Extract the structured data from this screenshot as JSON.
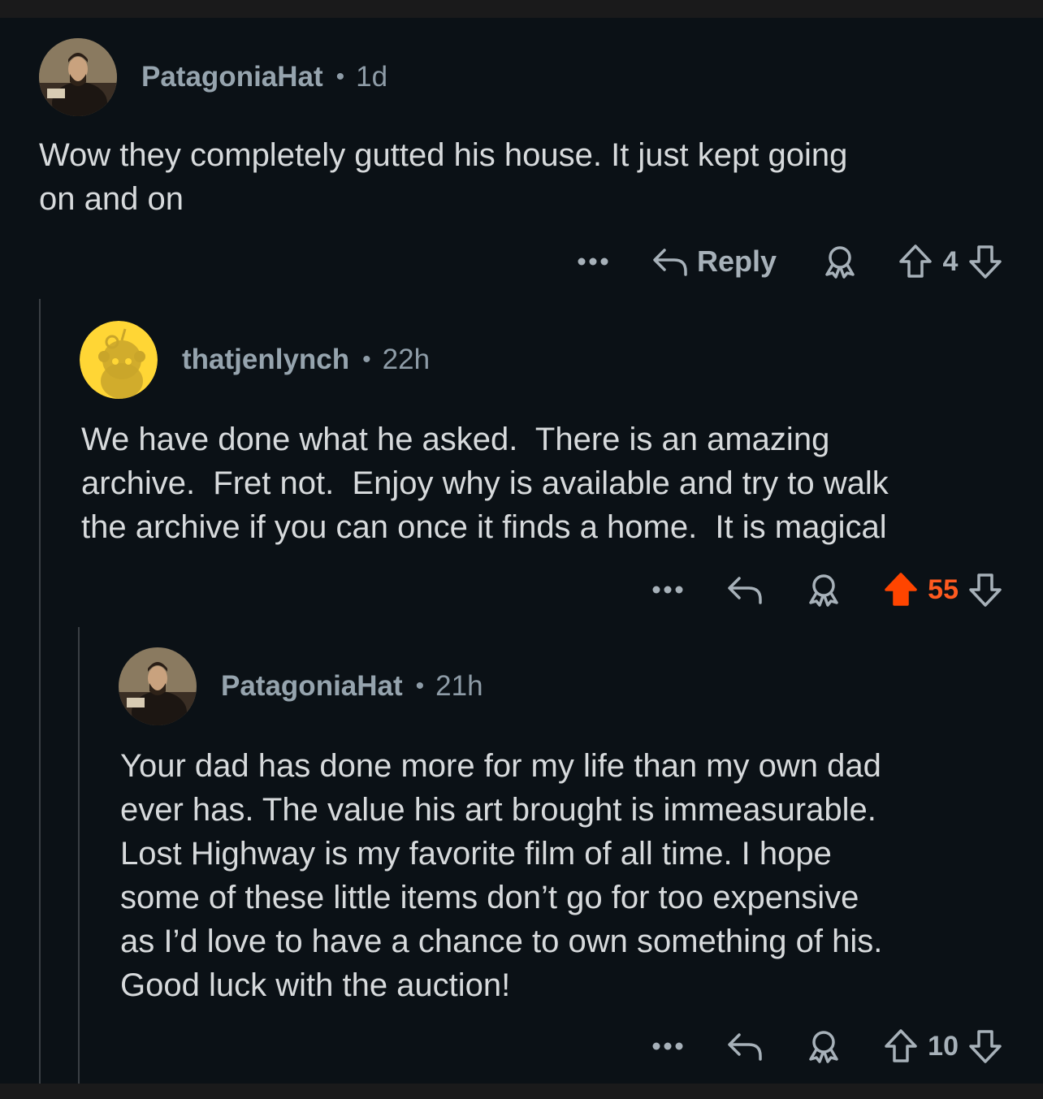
{
  "colors": {
    "background": "#0b1116",
    "text": "#d7dadc",
    "meta": "#8e9ca7",
    "upvoted": "#ff4500",
    "thread_line": "#3a3f44"
  },
  "comments": [
    {
      "username": "PatagoniaHat",
      "separator": "•",
      "age": "1d",
      "body": "Wow they completely gutted his house. It just kept going\non and on",
      "reply_label": "Reply",
      "score": "4",
      "upvoted": false,
      "avatar_icon": "user-portrait-avatar"
    },
    {
      "username": "thatjenlynch",
      "separator": "•",
      "age": "22h",
      "body": "We have done what he asked.  There is an amazing\narchive.  Fret not.  Enjoy why is available and try to walk\nthe archive if you can once it finds a home.  It is magical",
      "score": "55",
      "upvoted": true,
      "avatar_icon": "snoo-default-avatar"
    },
    {
      "username": "PatagoniaHat",
      "separator": "•",
      "age": "21h",
      "body": "Your dad has done more for my life than my own dad\never has. The value his art brought is immeasurable.\nLost Highway is my favorite film of all time. I hope\nsome of these little items don’t go for too expensive\nas I’d love to have a chance to own something of his.\nGood luck with the auction!",
      "score": "10",
      "upvoted": false,
      "avatar_icon": "user-portrait-avatar"
    }
  ]
}
